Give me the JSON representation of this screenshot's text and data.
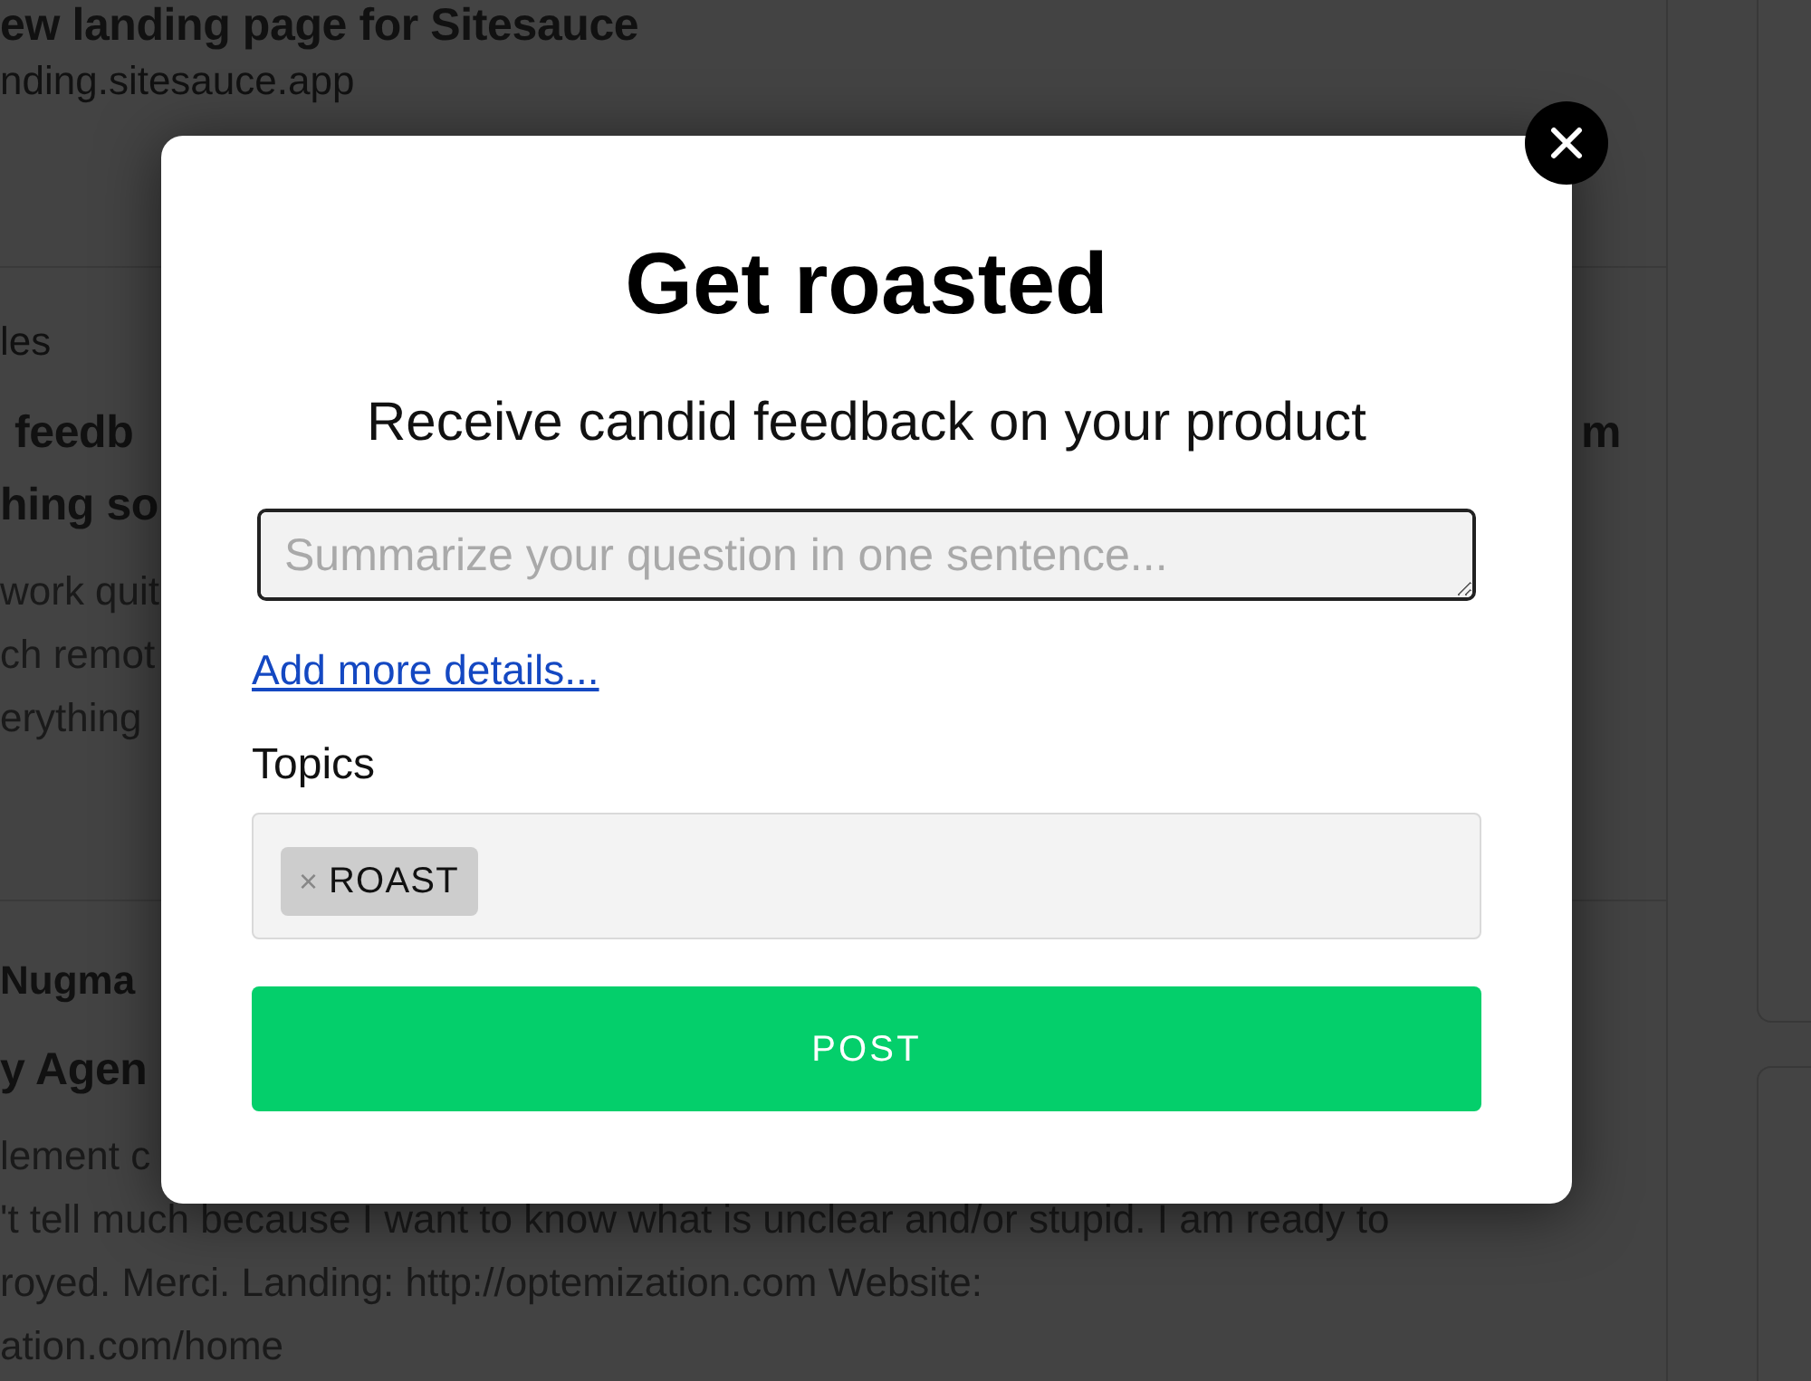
{
  "feed": {
    "posts": [
      {
        "title_lines": [
          {
            "left": "ew landing page for Sitesauce"
          }
        ],
        "url": "nding.sitesauce.app"
      },
      {
        "author": "les",
        "title_lines": [
          {
            "left": "feedb",
            "right": "m"
          },
          {
            "left": "hing so"
          }
        ],
        "body_lines": [
          "work quit",
          "ch remot",
          "erything"
        ]
      },
      {
        "author": "Nugma",
        "title_lines": [
          {
            "left": "y Agen"
          }
        ],
        "body_lines": [
          "lement c",
          "'t tell much because I want to know what is unclear and/or stupid. I am ready to",
          "royed. Merci. Landing: http://optemization.com Website:",
          "ation.com/home"
        ]
      }
    ]
  },
  "dialog": {
    "title": "Get roasted",
    "subtitle": "Receive candid feedback on your product",
    "question_field": {
      "placeholder": "Summarize your question in one sentence..."
    },
    "details_link": "Add more details...",
    "topics": {
      "label": "Topics",
      "tags": [
        {
          "remove": "×",
          "label": "ROAST"
        }
      ]
    },
    "post_button": "POST"
  }
}
